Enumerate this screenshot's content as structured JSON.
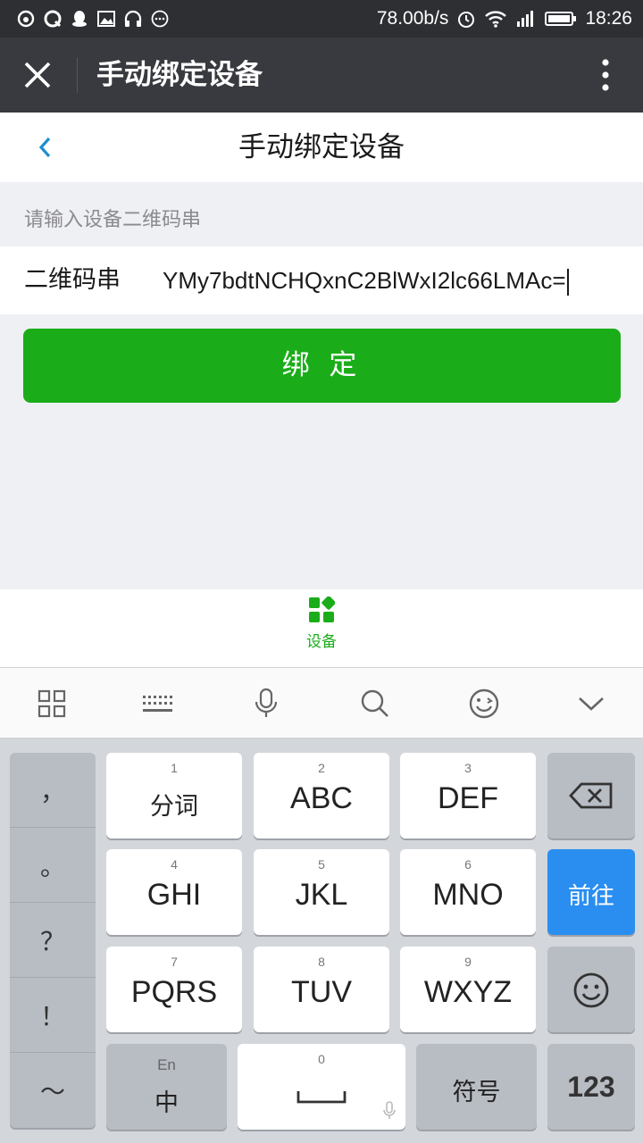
{
  "status_bar": {
    "net_speed": "78.00b/s",
    "time": "18:26",
    "notification_icons": [
      "weibo-icon",
      "qq-browser-icon",
      "qq-icon",
      "gallery-icon",
      "headset-icon",
      "more-dots-icon"
    ],
    "system_icons": [
      "alarm-icon",
      "wifi-icon",
      "signal-icon",
      "battery-icon"
    ]
  },
  "title_bar": {
    "title": "手动绑定设备"
  },
  "page_header": {
    "title": "手动绑定设备"
  },
  "form": {
    "section_label": "请输入设备二维码串",
    "field_label": "二维码串",
    "field_value": "YMy7bdtNCHQxnC2BlWxI2lc66LMAc="
  },
  "bind_button": {
    "label": "绑 定"
  },
  "tab_bar": {
    "device_label": "设备"
  },
  "colors": {
    "accent_green": "#1aad19",
    "keyboard_go_blue": "#2a8ef0"
  },
  "keyboard": {
    "punctuation": [
      "，",
      "。",
      "？",
      "！",
      "～"
    ],
    "keys": [
      {
        "num": "1",
        "label": "分词"
      },
      {
        "num": "2",
        "label": "ABC"
      },
      {
        "num": "3",
        "label": "DEF"
      },
      {
        "num": "4",
        "label": "GHI"
      },
      {
        "num": "5",
        "label": "JKL"
      },
      {
        "num": "6",
        "label": "MNO"
      },
      {
        "num": "7",
        "label": "PQRS"
      },
      {
        "num": "8",
        "label": "TUV"
      },
      {
        "num": "9",
        "label": "WXYZ"
      }
    ],
    "go_label": "前往",
    "lang_sub": "En",
    "lang_main": "中",
    "space_num": "0",
    "symbol_label": "符号",
    "num_label": "123"
  }
}
